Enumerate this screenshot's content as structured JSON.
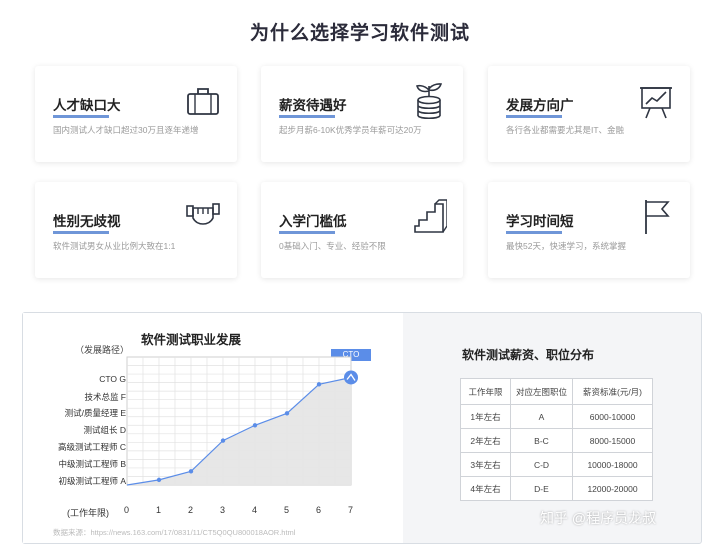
{
  "page": {
    "title": "为什么选择学习软件测试"
  },
  "cards": [
    {
      "title": "人才缺口大",
      "desc": "国内测试人才缺口超过30万且逐年递增",
      "icon": "briefcase-icon"
    },
    {
      "title": "薪资待遇好",
      "desc": "起步月薪6-10K优秀学员年薪可达20万",
      "icon": "money-plant-icon"
    },
    {
      "title": "发展方向广",
      "desc": "各行各业都需要尤其是IT、金融",
      "icon": "presentation-chart-icon"
    },
    {
      "title": "性别无歧视",
      "desc": "软件测试男女从业比例大致在1:1",
      "icon": "fist-icon"
    },
    {
      "title": "入学门槛低",
      "desc": "0基础入门、专业、经验不限",
      "icon": "stairs-box-icon"
    },
    {
      "title": "学习时间短",
      "desc": "最快52天，快速学习，系统掌握",
      "icon": "flag-icon"
    }
  ],
  "career_chart": {
    "title": "软件测试职业发展",
    "path_label": "（发展路径）",
    "x_axis_label": "(工作年限)",
    "cto_tag": "CTO",
    "source": "数据来源：https://news.163.com/17/0831/11/CT5Q0QU800018AOR.html"
  },
  "chart_data": {
    "type": "area",
    "title": "软件测试职业发展",
    "xlabel": "(工作年限)",
    "ylabel": "（发展路径）",
    "x": [
      0,
      1,
      2,
      3,
      4,
      5,
      6,
      7
    ],
    "y_levels": [
      {
        "code": "A",
        "label": "初级测试工程师"
      },
      {
        "code": "B",
        "label": "中级测试工程师"
      },
      {
        "code": "C",
        "label": "高级测试工程师"
      },
      {
        "code": "D",
        "label": "测试组长"
      },
      {
        "code": "E",
        "label": "测试/质量经理"
      },
      {
        "code": "F",
        "label": "技术总监"
      },
      {
        "code": "G",
        "label": "CTO"
      }
    ],
    "ylim": [
      0,
      7.5
    ],
    "xlim": [
      0,
      7
    ],
    "points": [
      {
        "x": 0,
        "y": 0.0
      },
      {
        "x": 1,
        "y": 0.3
      },
      {
        "x": 2,
        "y": 0.8
      },
      {
        "x": 3,
        "y": 2.6
      },
      {
        "x": 4,
        "y": 3.5
      },
      {
        "x": 5,
        "y": 4.2
      },
      {
        "x": 6,
        "y": 5.9
      },
      {
        "x": 7,
        "y": 6.3
      }
    ],
    "grid": true,
    "colors": {
      "line": "#5b8de8",
      "fill": "#e6e6e6",
      "marker": "#5b8de8"
    }
  },
  "salary_table": {
    "title": "软件测试薪资、职位分布",
    "headers": [
      "工作年限",
      "对应左图职位",
      "薪资标准(元/月)"
    ],
    "rows": [
      [
        "1年左右",
        "A",
        "6000-10000"
      ],
      [
        "2年左右",
        "B-C",
        "8000-15000"
      ],
      [
        "3年左右",
        "C-D",
        "10000-18000"
      ],
      [
        "4年左右",
        "D-E",
        "12000-20000"
      ]
    ]
  },
  "watermark": "知乎 @程序员龙叔",
  "colors": {
    "accent": "#6f96d8",
    "title": "#2b2b3a",
    "desc": "#9a9a9a"
  }
}
